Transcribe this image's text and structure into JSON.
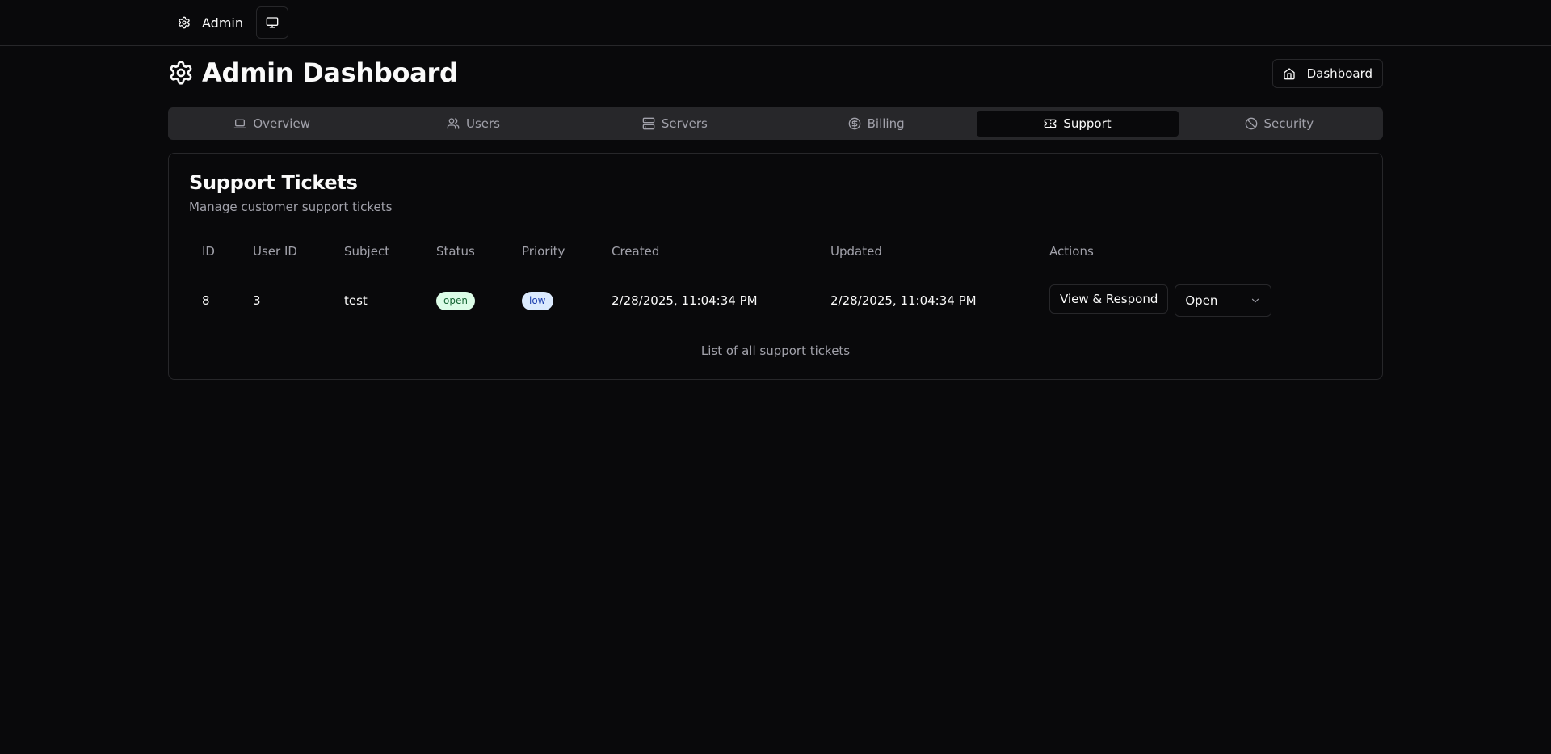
{
  "topbar": {
    "admin_label": "Admin",
    "admin_icon": "gear-icon",
    "monitor_icon": "monitor-icon"
  },
  "header": {
    "title": "Admin Dashboard",
    "title_icon": "gear-icon",
    "dashboard_button": "Dashboard",
    "dashboard_icon": "home-icon"
  },
  "tabs": [
    {
      "label": "Overview",
      "icon": "laptop-icon",
      "active": false
    },
    {
      "label": "Users",
      "icon": "users-icon",
      "active": false
    },
    {
      "label": "Servers",
      "icon": "server-icon",
      "active": false
    },
    {
      "label": "Billing",
      "icon": "dollar-circle-icon",
      "active": false
    },
    {
      "label": "Support",
      "icon": "ticket-icon",
      "active": true
    },
    {
      "label": "Security",
      "icon": "ban-icon",
      "active": false
    }
  ],
  "card": {
    "title": "Support Tickets",
    "description": "Manage customer support tickets",
    "caption": "List of all support tickets"
  },
  "table": {
    "columns": [
      "ID",
      "User ID",
      "Subject",
      "Status",
      "Priority",
      "Created",
      "Updated",
      "Actions"
    ],
    "rows": [
      {
        "id": "8",
        "user_id": "3",
        "subject": "test",
        "status": "open",
        "priority": "low",
        "created": "2/28/2025, 11:04:34 PM",
        "updated": "2/28/2025, 11:04:34 PM",
        "action_label": "View & Respond",
        "status_select": "Open"
      }
    ]
  },
  "colors": {
    "background": "#09090b",
    "border": "#27272a",
    "muted_text": "#a1a1aa",
    "tab_bg": "#27272a",
    "status_open_bg": "#dcfce7",
    "priority_low_bg": "#dbeafe"
  }
}
